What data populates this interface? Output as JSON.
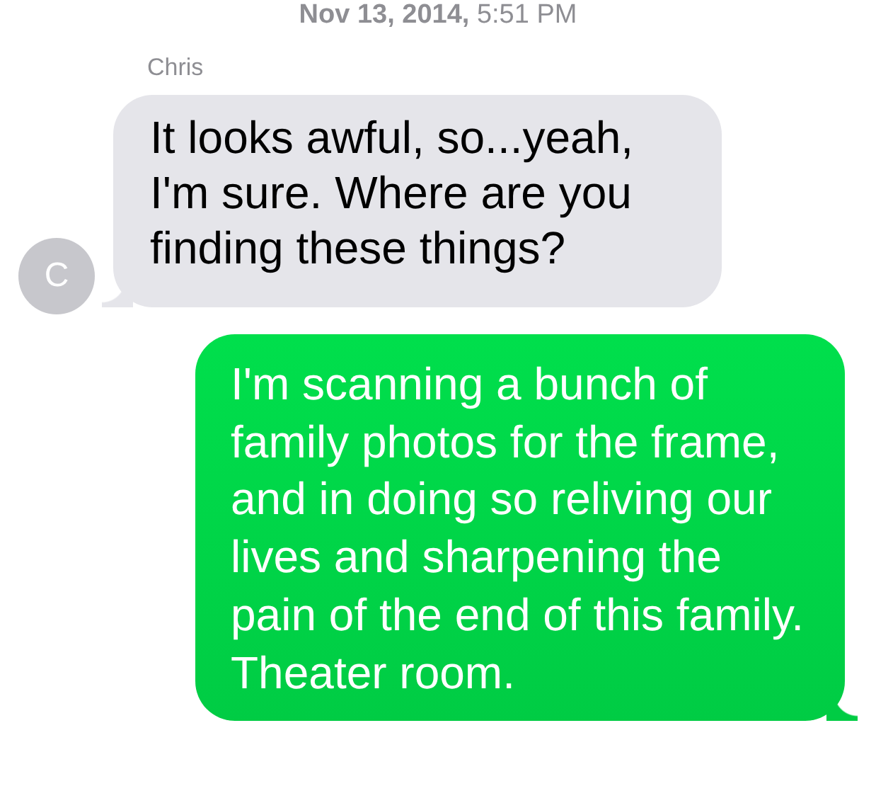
{
  "timestamp": "**Nov 13, 2014,** 5:51 PM",
  "messages": [
    {
      "kind": "received",
      "sender": "Chris",
      "avatar": "C",
      "text": "It looks awful, so...yeah, I'm sure.  Where are you finding these things?"
    },
    {
      "kind": "sent",
      "text": "I'm scanning a bunch of family photos for the frame, and in doing so reliving our lives and sharpening the pain of the end of this family. Theater room."
    }
  ]
}
